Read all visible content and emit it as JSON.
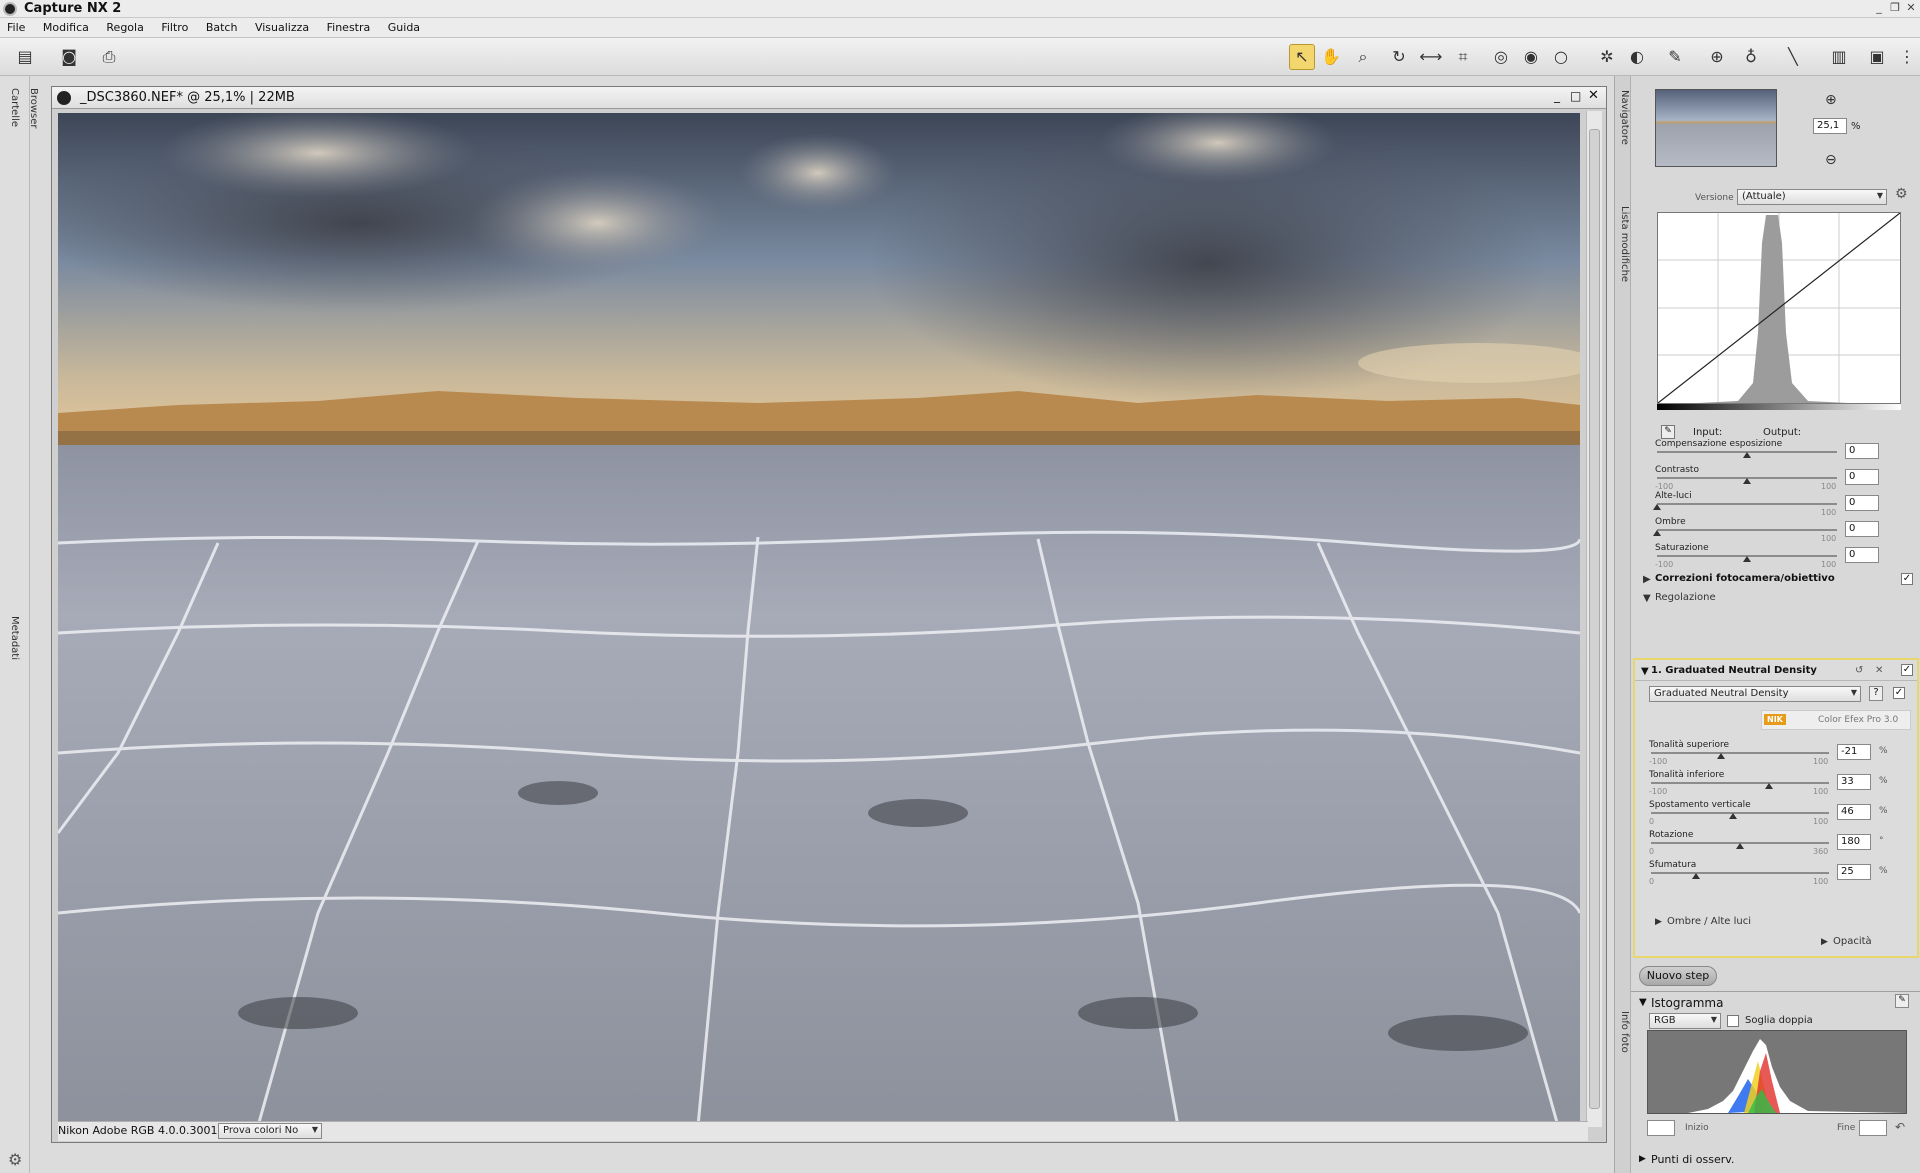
{
  "app": {
    "title": "Capture NX 2"
  },
  "menu": [
    "File",
    "Modifica",
    "Regola",
    "Filtro",
    "Batch",
    "Visualizza",
    "Finestra",
    "Guida"
  ],
  "toolbar": {
    "active_tool": "select-arrow"
  },
  "left_panel": {
    "tabs": [
      "Cartelle",
      "Browser",
      "Metadati"
    ]
  },
  "document": {
    "title": "_DSC3860.NEF* @ 25,1% | 22MB",
    "status": {
      "profile": "Nikon Adobe RGB 4.0.0.3001",
      "softproof": "Prova colori No"
    }
  },
  "navigator": {
    "tab": "Navigatore",
    "zoom_value": "25,1",
    "zoom_unit": "%"
  },
  "edit_list": {
    "tab": "Lista modifiche",
    "version_label": "Versione",
    "version_value": "(Attuale)",
    "curve": {
      "input_label": "Input:",
      "output_label": "Output:"
    },
    "base_sliders": [
      {
        "label": "Compensazione esposizione",
        "min": "",
        "max": "",
        "value": "0",
        "pos": 0.5
      },
      {
        "label": "Contrasto",
        "min": "-100",
        "max": "100",
        "value": "0",
        "pos": 0.5
      },
      {
        "label": "Alte-luci",
        "min": "",
        "max": "100",
        "value": "0",
        "pos": 0.0
      },
      {
        "label": "Ombre",
        "min": "",
        "max": "100",
        "value": "0",
        "pos": 0.0
      },
      {
        "label": "Saturazione",
        "min": "-100",
        "max": "100",
        "value": "0",
        "pos": 0.5
      }
    ],
    "camera_corrections": "Correzioni fotocamera/obiettivo",
    "adjust_header": "Regolazione",
    "step": {
      "title": "1. Graduated Neutral Density",
      "filter": "Graduated Neutral Density",
      "brand_nik": "NIK",
      "brand_product": "Color Efex Pro 3.0",
      "sliders": [
        {
          "label": "Tonalità superiore",
          "min": "-100",
          "max": "100",
          "value": "-21",
          "unit": "%",
          "pos": 0.395
        },
        {
          "label": "Tonalità inferiore",
          "min": "-100",
          "max": "100",
          "value": "33",
          "unit": "%",
          "pos": 0.665
        },
        {
          "label": "Spostamento verticale",
          "min": "0",
          "max": "100",
          "value": "46",
          "unit": "%",
          "pos": 0.46
        },
        {
          "label": "Rotazione",
          "min": "0",
          "max": "360",
          "value": "180",
          "unit": "°",
          "pos": 0.5
        },
        {
          "label": "Sfumatura",
          "min": "0",
          "max": "100",
          "value": "25",
          "unit": "%",
          "pos": 0.25
        }
      ],
      "shadows_highlights": "Ombre / Alte luci",
      "opacity": "Opacità"
    },
    "new_step": "Nuovo step"
  },
  "photo_info": {
    "tab": "Info foto",
    "histogram_title": "Istogramma",
    "channel": "RGB",
    "double_threshold": "Soglia doppia",
    "start_label": "Inizio",
    "end_label": "Fine",
    "watch_points": "Punti di osserv."
  }
}
